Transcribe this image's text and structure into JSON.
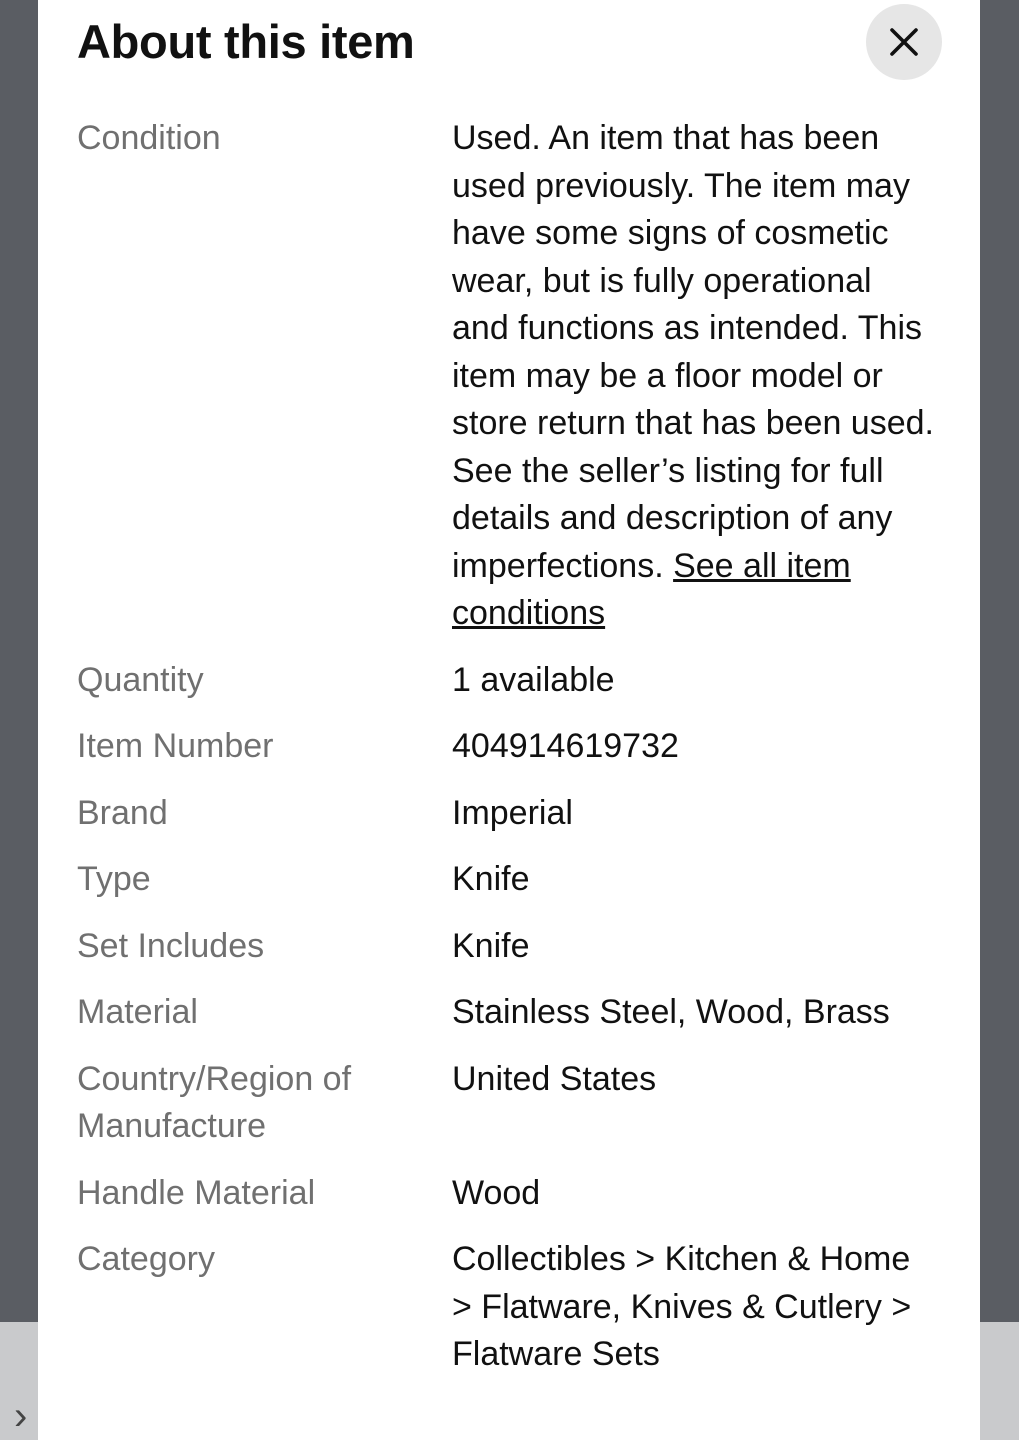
{
  "dialog": {
    "title": "About this item",
    "close_icon": "close-icon"
  },
  "specs": {
    "condition": {
      "label": "Condition",
      "text": "Used. An item that has been used previously. The item may have some signs of cosmetic wear, but is fully operational and functions as intended. This item may be a floor model or store return that has been used. See the seller’s listing for full details and description of any imperfections.",
      "link": "See all item conditions"
    },
    "quantity": {
      "label": "Quantity",
      "value": "1 available"
    },
    "item_number": {
      "label": "Item Number",
      "value": "404914619732"
    },
    "brand": {
      "label": "Brand",
      "value": "Imperial"
    },
    "type": {
      "label": "Type",
      "value": "Knife"
    },
    "set_includes": {
      "label": "Set Includes",
      "value": "Knife"
    },
    "material": {
      "label": "Material",
      "value": "Stainless Steel, Wood, Brass"
    },
    "country": {
      "label": "Country/Region of Manufacture",
      "value": "United States"
    },
    "handle_material": {
      "label": "Handle Material",
      "value": "Wood"
    },
    "category": {
      "label": "Category",
      "value": "Collectibles > Kitchen & Home > Flatware, Knives & Cutlery > Flatware Sets"
    }
  },
  "backdrop": {
    "chevron_icon": "chevron-right-icon",
    "chevron_glyph": "›"
  }
}
